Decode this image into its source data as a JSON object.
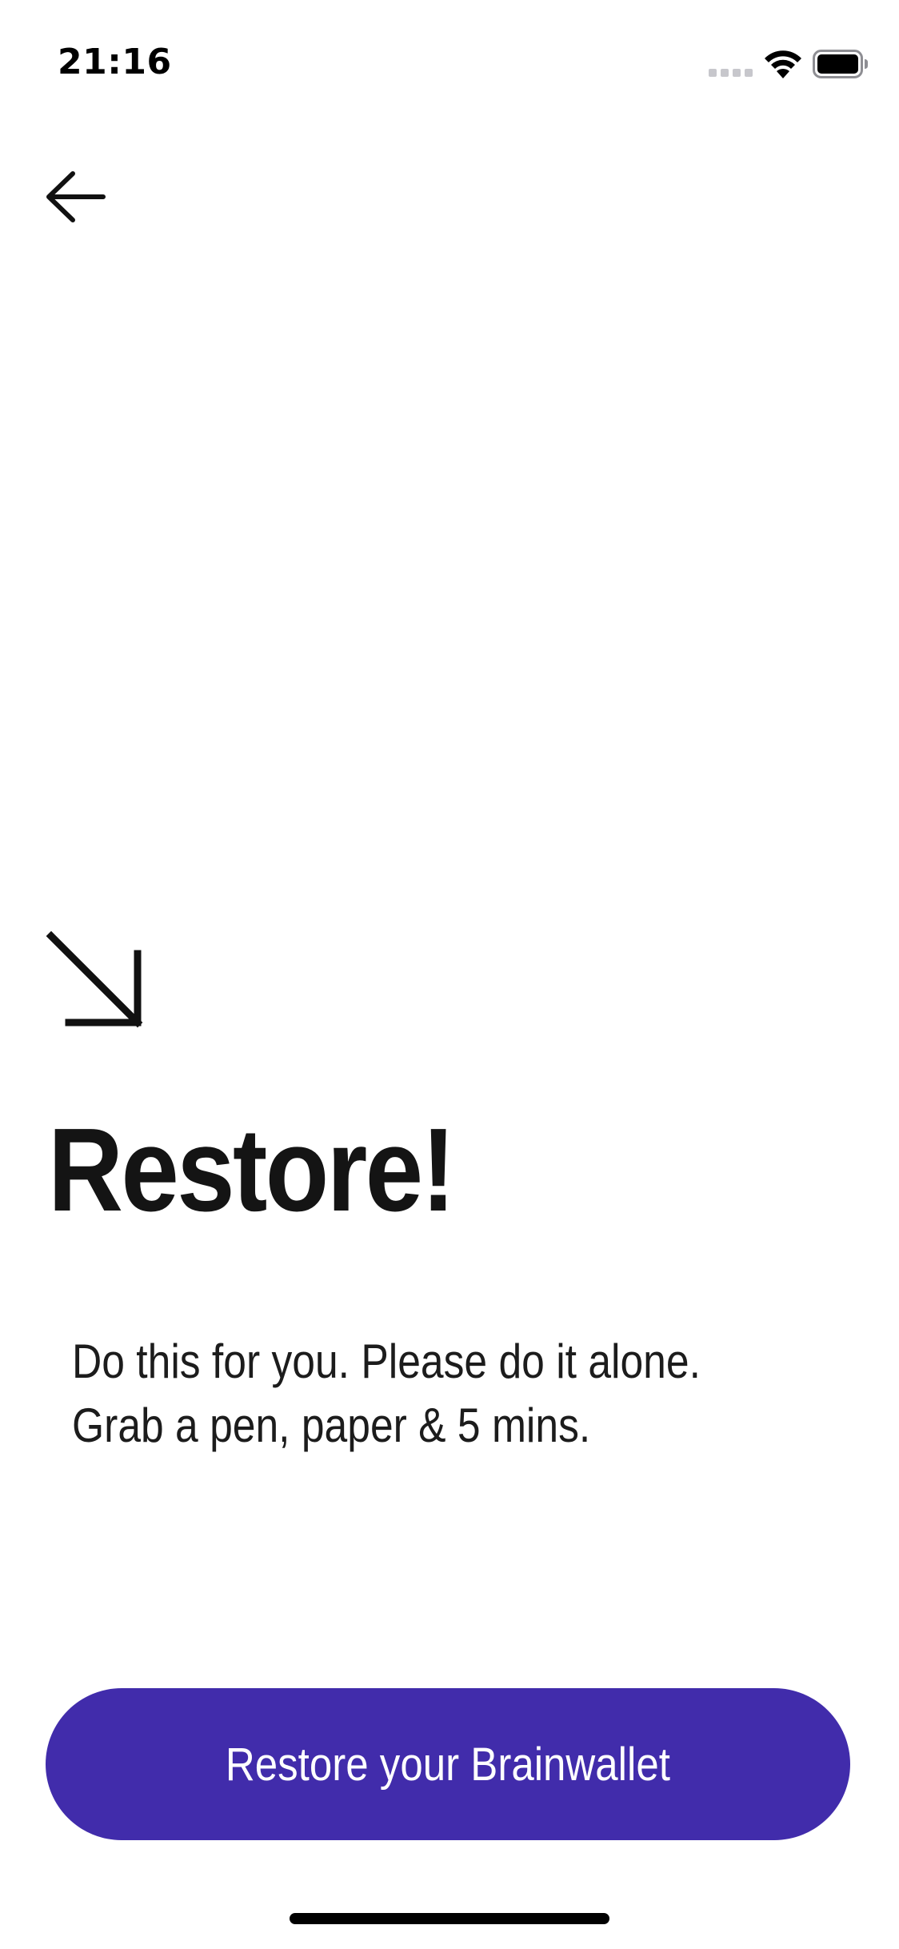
{
  "status_bar": {
    "time": "21:16",
    "signal_icon": "cellular-signal-icon",
    "wifi_icon": "wifi-icon",
    "battery_icon": "battery-icon"
  },
  "navigation": {
    "back_icon": "arrow-left-icon"
  },
  "hero": {
    "icon": "arrow-down-right-icon",
    "title": "Restore!",
    "description_lines": [
      "Do this for you. Please do it alone.",
      "Grab a pen, paper & 5 mins."
    ]
  },
  "actions": {
    "primary_label": "Restore your Brainwallet"
  },
  "colors": {
    "primary": "#412cab",
    "text": "#141414",
    "background": "#ffffff"
  }
}
